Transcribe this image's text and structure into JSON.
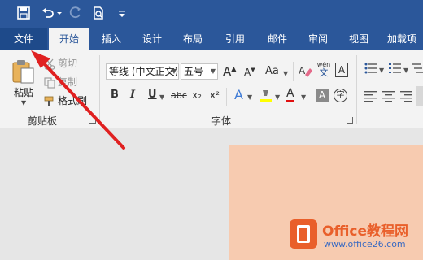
{
  "quick_access": {
    "icons": [
      "save-icon",
      "undo-icon",
      "redo-icon",
      "print-preview-icon",
      "customize-icon"
    ]
  },
  "tabs": {
    "file": "文件",
    "home": "开始",
    "insert": "插入",
    "design": "设计",
    "layout": "布局",
    "references": "引用",
    "mailings": "邮件",
    "review": "审阅",
    "view": "视图",
    "addins": "加载项"
  },
  "clipboard": {
    "group_label": "剪贴板",
    "paste": "粘贴",
    "cut": "剪切",
    "copy": "复制",
    "format_painter": "格式刷"
  },
  "font": {
    "group_label": "字体",
    "font_name": "等线 (中文正文)",
    "font_size": "五号",
    "grow": "A",
    "shrink": "A",
    "change_case": "Aa",
    "phonetic_top": "wén",
    "phonetic_bottom": "文",
    "char_border": "A",
    "bold": "B",
    "italic": "I",
    "underline": "U",
    "strikethrough": "abc",
    "subscript": "x₂",
    "superscript": "x²",
    "text_effects": "A",
    "font_color": "A",
    "char_shading": "A",
    "enclose": "字"
  },
  "colors": {
    "ribbon_blue": "#2b579a",
    "highlight_yellow": "#ffff00",
    "font_red": "#e01010",
    "arrow_red": "#e02020",
    "page_peach": "#f7cbb0"
  },
  "watermark": {
    "title": "Office教程网",
    "url": "www.office26.com"
  }
}
